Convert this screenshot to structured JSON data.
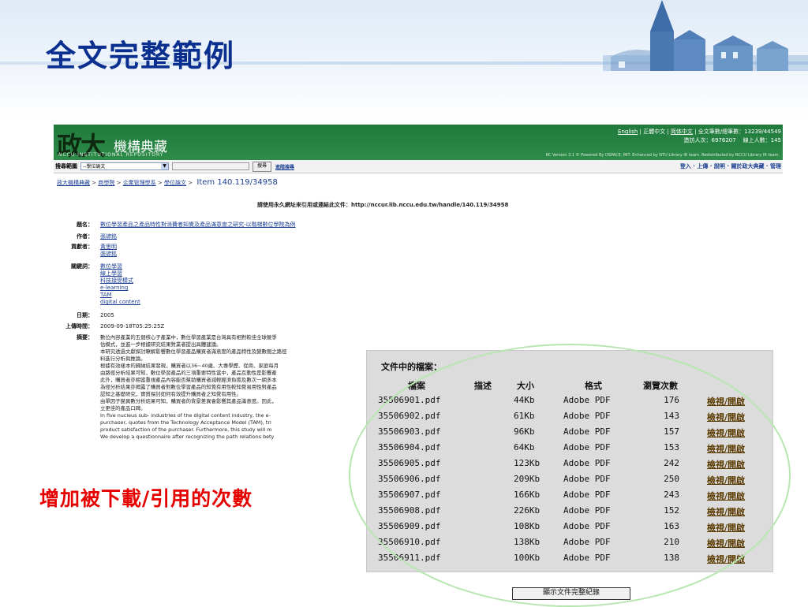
{
  "slide": {
    "title": "全文完整範例",
    "callout": "增加被下載/引用的次數"
  },
  "site": {
    "logo_big": "政大",
    "logo_sub": "機構典藏",
    "logo_en": "NCCU INSTITUTIONAL REPOSITORY",
    "lang_links": [
      "English",
      "正體中文",
      "简体中文"
    ],
    "stats_line1": "全文筆數/總筆數：13239/44549",
    "stats_line2a": "造訪人次：6976207",
    "stats_line2b": "線上人數：145",
    "powered_by": "RC Version 3.1 © Powered By DSPACE, MIT. Enhanced by NTU Library IR team. Redistributed by NCCU Library IR team."
  },
  "search": {
    "scope_label": "搜尋範圍",
    "scope_value": "--學位論文",
    "button": "搜尋",
    "advanced": "進階搜尋",
    "top_links": [
      "登入",
      "上傳",
      "說明",
      "關於政大典藏",
      "管理"
    ]
  },
  "breadcrumb": {
    "items": [
      "政大機構典藏",
      "商學院",
      "企業管理學系",
      "學位論文"
    ],
    "item_id": "Item 140.119/34958"
  },
  "permalink": "請使用永久網址來引用或連結此文件：http://nccur.lib.nccu.edu.tw/handle/140.119/34958",
  "meta": {
    "title_label": "題名：",
    "title": "數位學習產品之產品特性對消費者知覺及產品滿意度之研究-以階梯數位學院為例",
    "author_label": "作者：",
    "author": "張諺銘",
    "contributor_label": "貢獻者：",
    "contributors": [
      "黃思明",
      "張諺銘"
    ],
    "keywords_label": "關鍵詞：",
    "keywords": [
      "數位學習",
      "線上學習",
      "科技接受模式",
      "e-learning",
      "TAM",
      "digital content"
    ],
    "date_label": "日期：",
    "date": "2005",
    "upload_label": "上傳時間：",
    "upload": "2009-09-18T05:25:25Z",
    "abstract_label": "摘要：",
    "abstract_lines": [
      "數位內容產業的五個核心子產業中，數位學習產業是台灣具有相對較佳全球競爭",
      "估模式，並進一步根據研究結果對業者提出具體建議。",
      "本研究透過文獻探討瞭解影響數位學習產品購買者滿意度的產品特性及變數間之路徑",
      "料進行分析與推論。",
      "根據有效樣本的歸納結果發現，購買者以36~40歲、大專學歷、從商、家庭每月",
      "由路徑分析結果可知，數位學習產品的三項重要特性當中，產品互動性是影響產",
      "此外，購買者亦相當重視產品內容能否幫助購買者減輕經濟負擔及數次一網多本",
      "為徑分析結果亦揭露了購買者對數位學習產品的知覺有用性較知覺易用性對產品",
      "認知之基礎研究，實質探討如何有效提升購買者之知覺有用性。",
      "由單因子變異數分析結果可知，購買者的背景差異會影響其產品滿意度。因此，",
      "立更佳的產品口碑。",
      "In five nucleus sub- industries of the digital content industry, the e-",
      "purchaser, quotes from the Technology Acceptance Model (TAM), tri",
      "product satisfaction of the purchaser. Furthermore, this study will m",
      "We develop a questionnaire after recognizing the path relations bety"
    ]
  },
  "files": {
    "title": "文件中的檔案：",
    "headers": [
      "檔案",
      "描述",
      "大小",
      "格式",
      "瀏覽次數"
    ],
    "view_label": "檢視/開啟",
    "rows": [
      {
        "name": "35506901.pdf",
        "size": "44Kb",
        "format": "Adobe PDF",
        "views": "176"
      },
      {
        "name": "35506902.pdf",
        "size": "61Kb",
        "format": "Adobe PDF",
        "views": "143"
      },
      {
        "name": "35506903.pdf",
        "size": "96Kb",
        "format": "Adobe PDF",
        "views": "157"
      },
      {
        "name": "35506904.pdf",
        "size": "64Kb",
        "format": "Adobe PDF",
        "views": "153"
      },
      {
        "name": "35506905.pdf",
        "size": "123Kb",
        "format": "Adobe PDF",
        "views": "242"
      },
      {
        "name": "35506906.pdf",
        "size": "209Kb",
        "format": "Adobe PDF",
        "views": "250"
      },
      {
        "name": "35506907.pdf",
        "size": "166Kb",
        "format": "Adobe PDF",
        "views": "243"
      },
      {
        "name": "35506908.pdf",
        "size": "226Kb",
        "format": "Adobe PDF",
        "views": "152"
      },
      {
        "name": "35506909.pdf",
        "size": "108Kb",
        "format": "Adobe PDF",
        "views": "163"
      },
      {
        "name": "35506910.pdf",
        "size": "138Kb",
        "format": "Adobe PDF",
        "views": "210"
      },
      {
        "name": "35506911.pdf",
        "size": "100Kb",
        "format": "Adobe PDF",
        "views": "138"
      }
    ],
    "full_record_button": "顯示文件完整紀錄"
  },
  "colors": {
    "title": "#0a2f8f",
    "callout": "#e60000",
    "header_green": "#2e8b49",
    "link": "#1c3f94",
    "circle": "#b7e6b0"
  }
}
